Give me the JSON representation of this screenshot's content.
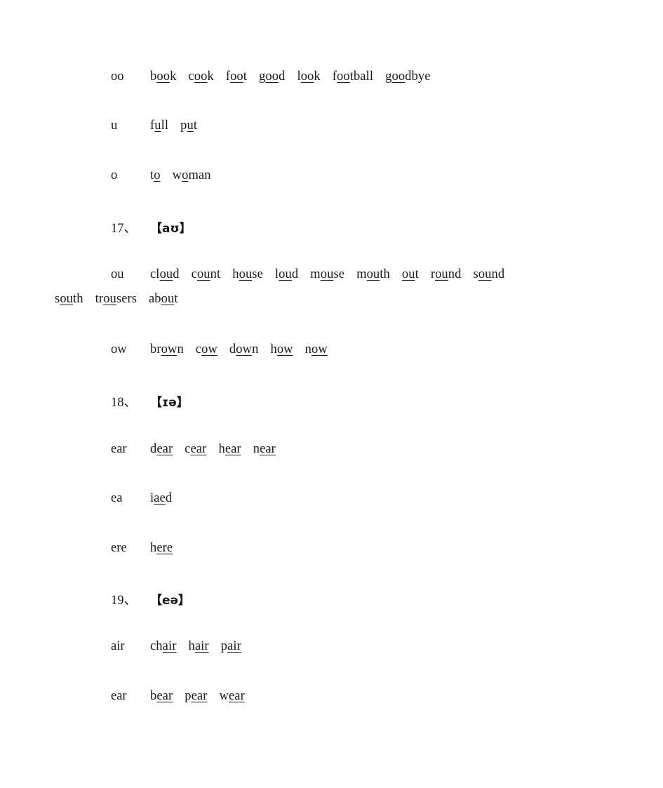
{
  "document": {
    "type": "phonics-word-list",
    "text_color": "#1a1a1a",
    "background_color": "#ffffff"
  },
  "rows": [
    {
      "id": "oo-row",
      "grapheme": "oo",
      "words": [
        {
          "pre": "b",
          "mark": "oo",
          "post": "k"
        },
        {
          "pre": "c",
          "mark": "oo",
          "post": "k"
        },
        {
          "pre": "f",
          "mark": "oo",
          "post": "t"
        },
        {
          "pre": "g",
          "mark": "oo",
          "post": "d"
        },
        {
          "pre": "l",
          "mark": "oo",
          "post": "k"
        },
        {
          "pre": "f",
          "mark": "oo",
          "post": "tball"
        },
        {
          "pre": "g",
          "mark": "oo",
          "post": "dbye"
        }
      ]
    },
    {
      "id": "u-row",
      "grapheme": "u",
      "words": [
        {
          "pre": "f",
          "mark": "u",
          "post": "ll"
        },
        {
          "pre": "p",
          "mark": "u",
          "post": "t"
        }
      ]
    },
    {
      "id": "o-row",
      "grapheme": "o",
      "words": [
        {
          "pre": "t",
          "mark": "o",
          "post": ""
        },
        {
          "pre": "w",
          "mark": "o",
          "post": "man"
        }
      ]
    }
  ],
  "section_17": {
    "number": "17、",
    "ipa": "【aʊ】",
    "rows": [
      {
        "id": "ou-row",
        "grapheme": "ou",
        "words": [
          {
            "pre": "cl",
            "mark": "ou",
            "post": "d"
          },
          {
            "pre": "c",
            "mark": "ou",
            "post": "nt"
          },
          {
            "pre": "h",
            "mark": "ou",
            "post": "se"
          },
          {
            "pre": "l",
            "mark": "ou",
            "post": "d"
          },
          {
            "pre": "m",
            "mark": "ou",
            "post": "se"
          },
          {
            "pre": "m",
            "mark": "ou",
            "post": "th"
          },
          {
            "pre": "",
            "mark": "ou",
            "post": "t"
          },
          {
            "pre": "r",
            "mark": "ou",
            "post": "nd"
          },
          {
            "pre": "s",
            "mark": "ou",
            "post": "nd"
          }
        ],
        "wrapped_words": [
          {
            "pre": "s",
            "mark": "ou",
            "post": "th"
          },
          {
            "pre": "tr",
            "mark": "ou",
            "post": "sers"
          },
          {
            "pre": "ab",
            "mark": "ou",
            "post": "t"
          }
        ]
      },
      {
        "id": "ow-row",
        "grapheme": "ow",
        "words": [
          {
            "pre": "br",
            "mark": "ow",
            "post": "n"
          },
          {
            "pre": "c",
            "mark": "ow",
            "post": ""
          },
          {
            "pre": "d",
            "mark": "ow",
            "post": "n"
          },
          {
            "pre": "h",
            "mark": "ow",
            "post": ""
          },
          {
            "pre": "n",
            "mark": "ow",
            "post": ""
          }
        ]
      }
    ]
  },
  "section_18": {
    "number": "18、",
    "ipa": "【ɪə】",
    "rows": [
      {
        "id": "ear-row-18",
        "grapheme": "ear",
        "words": [
          {
            "pre": "d",
            "mark": "ear",
            "post": ""
          },
          {
            "pre": "c",
            "mark": "ear",
            "post": ""
          },
          {
            "pre": "h",
            "mark": "ear",
            "post": ""
          },
          {
            "pre": "n",
            "mark": "ear",
            "post": ""
          }
        ]
      },
      {
        "id": "ea-row-18",
        "grapheme": "ea",
        "words": [
          {
            "pre": "i",
            "mark": "ae",
            "post": "d"
          }
        ]
      },
      {
        "id": "ere-row-18",
        "grapheme": "ere",
        "words": [
          {
            "pre": "h",
            "mark": "ere",
            "post": ""
          }
        ]
      }
    ]
  },
  "section_19": {
    "number": "19、",
    "ipa": "【eə】",
    "rows": [
      {
        "id": "air-row-19",
        "grapheme": "air",
        "words": [
          {
            "pre": "ch",
            "mark": "air",
            "post": ""
          },
          {
            "pre": "h",
            "mark": "air",
            "post": ""
          },
          {
            "pre": "p",
            "mark": "air",
            "post": ""
          }
        ]
      },
      {
        "id": "ear-row-19",
        "grapheme": "ear",
        "words": [
          {
            "pre": "b",
            "mark": "ear",
            "post": ""
          },
          {
            "pre": "p",
            "mark": "ear",
            "post": ""
          },
          {
            "pre": "w",
            "mark": "ear",
            "post": ""
          }
        ]
      }
    ]
  }
}
